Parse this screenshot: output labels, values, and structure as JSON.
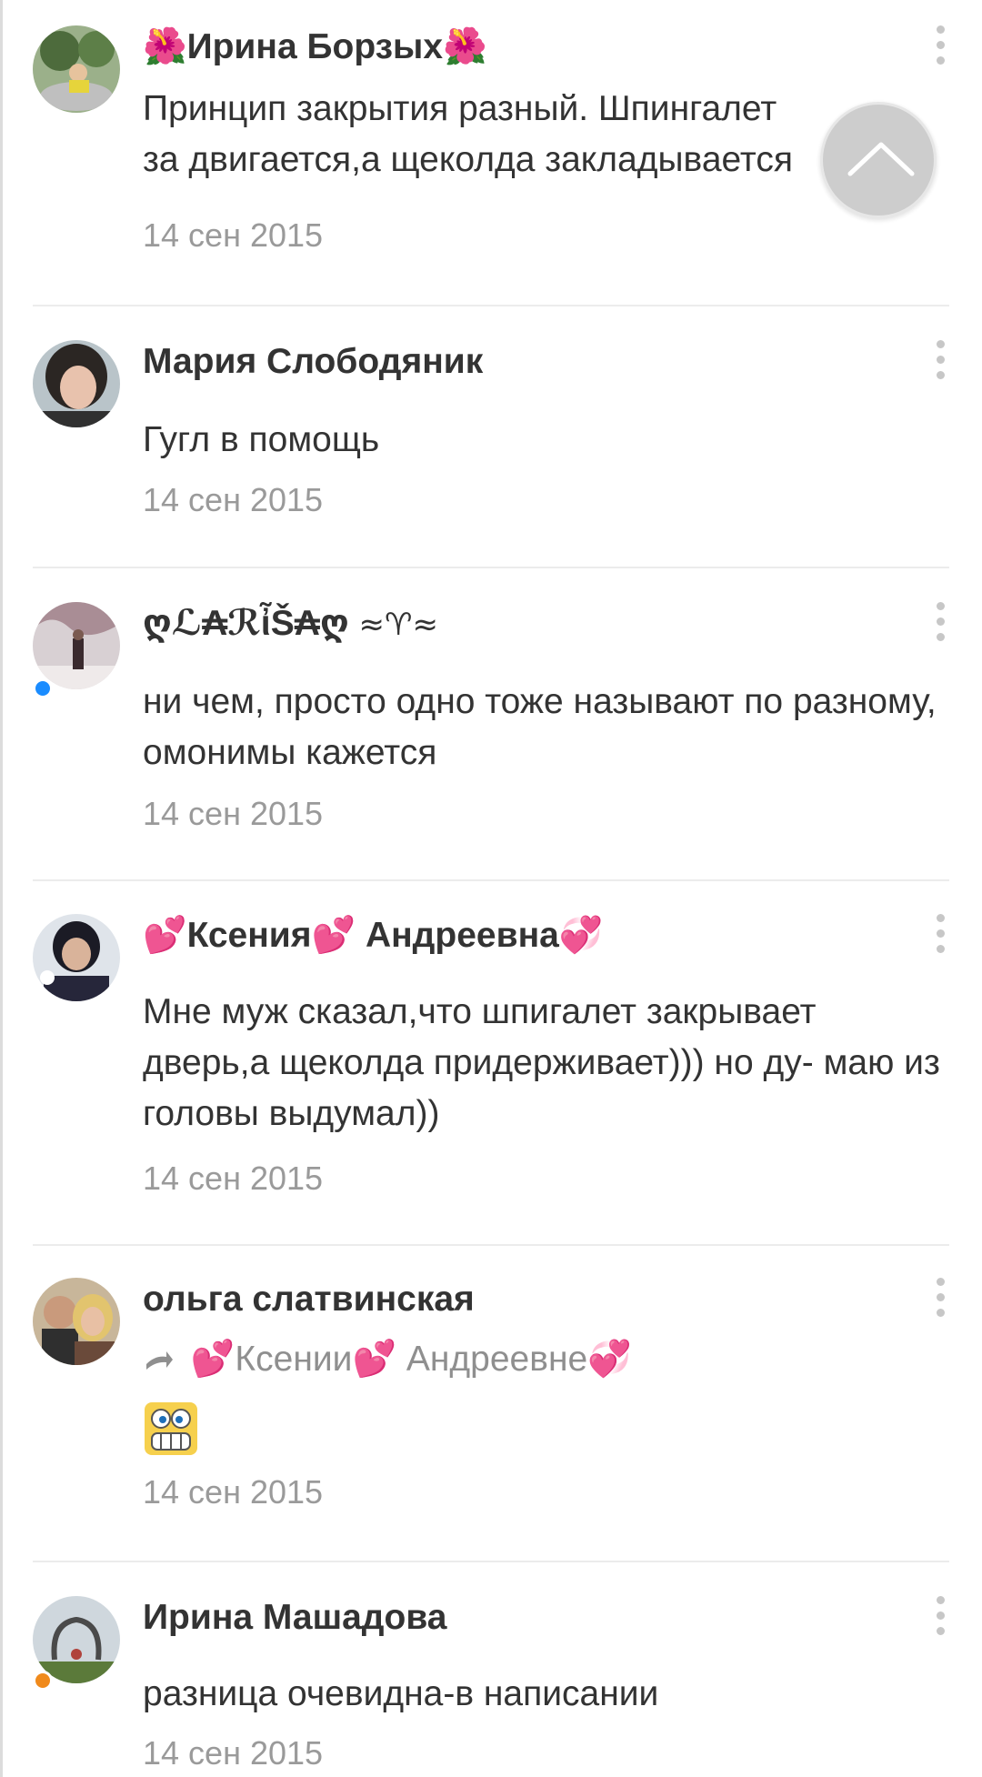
{
  "comments": [
    {
      "name": "Ирина Борзых",
      "name_prefix": "🌺",
      "name_suffix": "🌺",
      "text_line1": "Принцип закрытия разный. Шпингалет",
      "text_line2": "за двигается,а щеколда закладывается",
      "date": "14 сен 2015"
    },
    {
      "name": "Мария Слободяник",
      "text": "Гугл в помощь",
      "date": "14 сен 2015"
    },
    {
      "name": "ღℒ₳ℛἶŠ₳ღ",
      "name_suffix": " ≈♈≈",
      "text": "ни чем, просто одно  тоже называют по разному, омонимы кажется",
      "date": "14 сен 2015"
    },
    {
      "name_part1": "Ксения",
      "name_part2": "Андреевна",
      "heart": "💕",
      "heart2": "💞",
      "text": "Мне муж сказал,что шпигалет закрывает дверь,а щеколда придерживает))) но ду- маю из головы выдумал))",
      "date": "14 сен 2015"
    },
    {
      "name": "ольга слатвинская",
      "reply_to_part1": "Ксении",
      "reply_to_part2": "Андреевне",
      "reply_icon": "reply-arrow-icon",
      "sticker": "grinning-sticker",
      "date": "14 сен 2015"
    },
    {
      "name": "Ирина Машадова",
      "text": "разница очевидна-в написании",
      "date": "14 сен 2015"
    }
  ],
  "colors": {
    "status_online_blue": "#1a8cff",
    "status_online_orange": "#f08a1c",
    "date_gray": "#9a9a9a"
  },
  "scroll_top_icon": "chevron-up-icon"
}
